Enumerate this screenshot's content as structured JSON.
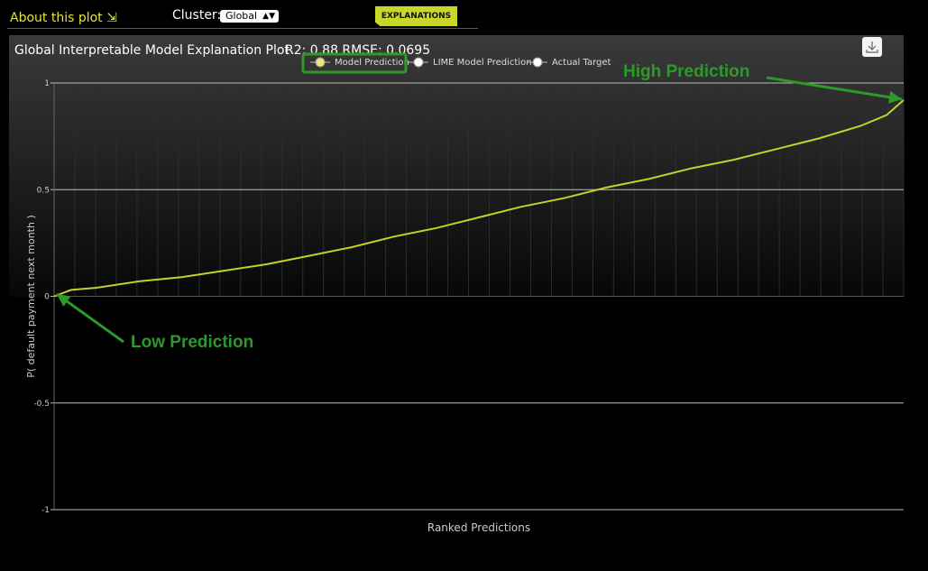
{
  "header": {
    "about_label": "About this plot ⇲",
    "cluster_label": "Cluster:",
    "cluster_value": "Global",
    "explanations_button": "EXPLANATIONS"
  },
  "annotations": {
    "high": "High Prediction",
    "low": "Low Prediction"
  },
  "colors": {
    "model_prediction": "#c7cf2a",
    "annotation_green": "#2b9a2b"
  },
  "chart_data": {
    "type": "line",
    "title": "Global Interpretable Model Explanation Plot",
    "subtitle": "R2: 0.88   RMSE: 0.0695",
    "xlabel": "Ranked Predictions",
    "ylabel": "P( default payment next month )",
    "ylim": [
      -1,
      1
    ],
    "y_ticks": [
      "1",
      "0.5",
      "0",
      "-0.5",
      "-1"
    ],
    "grid": true,
    "legend_position": "top-center",
    "legend": [
      "Model Prediction",
      "LIME Model Prediction",
      "Actual Target"
    ],
    "series": [
      {
        "name": "Model Prediction",
        "x": [
          0,
          0.02,
          0.05,
          0.1,
          0.15,
          0.2,
          0.25,
          0.3,
          0.35,
          0.4,
          0.45,
          0.5,
          0.55,
          0.6,
          0.65,
          0.7,
          0.75,
          0.8,
          0.85,
          0.9,
          0.95,
          0.98,
          1.0
        ],
        "values": [
          0.0,
          0.03,
          0.04,
          0.07,
          0.09,
          0.12,
          0.15,
          0.19,
          0.23,
          0.28,
          0.32,
          0.37,
          0.42,
          0.46,
          0.51,
          0.55,
          0.6,
          0.64,
          0.69,
          0.74,
          0.8,
          0.85,
          0.92
        ]
      }
    ]
  }
}
